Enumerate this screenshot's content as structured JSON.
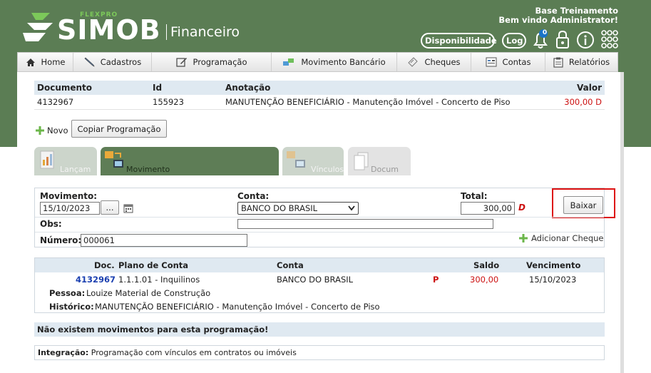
{
  "header": {
    "logo_tag": "FLEXPRO",
    "logo_name": "SIMOB",
    "logo_module": "Financeiro",
    "base_name": "Base Treinamento",
    "welcome": "Bem vindo Administrator!",
    "availability_label": "Disponibilidade",
    "log_label": "Log",
    "notification_count": "0"
  },
  "nav": [
    {
      "label": "Home",
      "icon": "home-icon"
    },
    {
      "label": "Cadastros",
      "icon": "pencil-icon"
    },
    {
      "label": "Programação",
      "icon": "edit-icon"
    },
    {
      "label": "Movimento Bancário",
      "icon": "bank-icon"
    },
    {
      "label": "Cheques",
      "icon": "check-icon"
    },
    {
      "label": "Contas",
      "icon": "accounts-icon"
    },
    {
      "label": "Relatórios",
      "icon": "report-icon"
    }
  ],
  "document": {
    "headers": {
      "documento": "Documento",
      "id": "Id",
      "anotacao": "Anotação",
      "valor": "Valor"
    },
    "row": {
      "documento": "4132967",
      "id": "155923",
      "anotacao": "MANUTENÇÃO BENEFICIÁRIO - Manutenção Imóvel - Concerto de Piso",
      "valor": "300,00 D"
    }
  },
  "actions": {
    "novo_label": "Novo",
    "copiar_label": "Copiar Programação"
  },
  "tabs": [
    {
      "label": "Lançam",
      "active": false
    },
    {
      "label": "Movimento",
      "active": true
    },
    {
      "label": "Vínculos",
      "active": false
    },
    {
      "label": "Docum",
      "active": false
    }
  ],
  "form": {
    "movimento_label": "Movimento:",
    "movimento_value": "15/10/2023",
    "date_button": "...",
    "conta_label": "Conta:",
    "conta_value": "BANCO DO BRASIL",
    "total_label": "Total:",
    "total_value": "300,00",
    "total_flag": "D",
    "obs_label": "Obs:",
    "obs_value": "",
    "numero_label": "Número:",
    "numero_value": "000061",
    "adicionar_cheque": "Adicionar Cheque",
    "baixar_label": "Baixar"
  },
  "movements": {
    "headers": {
      "doc": "Doc.",
      "plano": "Plano de Conta",
      "conta": "Conta",
      "saldo": "Saldo",
      "vencimento": "Vencimento"
    },
    "row": {
      "doc": "4132967",
      "plano": "1.1.1.01 - Inquilinos",
      "conta": "BANCO DO BRASIL",
      "flag": "P",
      "saldo": "300,00",
      "vencimento": "15/10/2023",
      "pessoa_label": "Pessoa:",
      "pessoa_value": "Louize Material de Construção",
      "historico_label": "Histórico:",
      "historico_value": "MANUTENÇÃO BENEFICIÁRIO - Manutenção Imóvel - Concerto de Piso"
    }
  },
  "messages": {
    "no_movements": "Não existem movimentos para esta programação!",
    "integracao_label": "Integração:",
    "integracao_value": "Programação com vínculos em contratos ou imóveis"
  }
}
